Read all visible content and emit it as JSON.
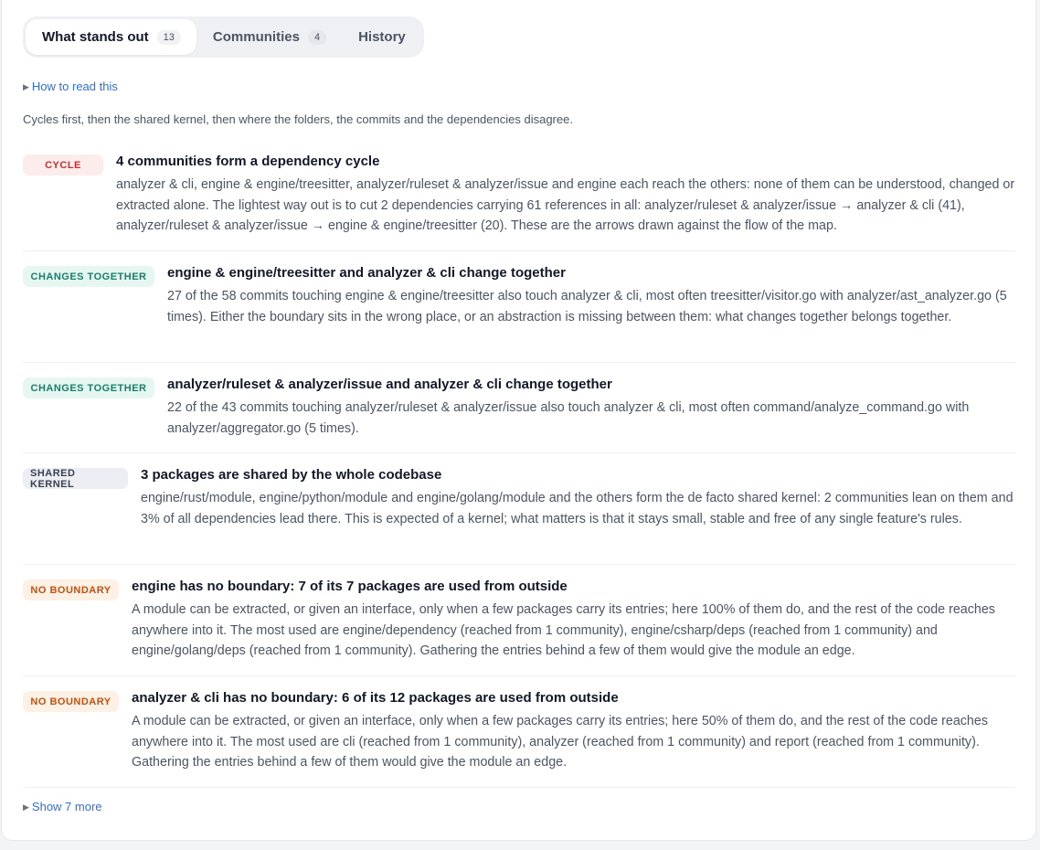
{
  "tabs": [
    {
      "label": "What stands out",
      "count": "13"
    },
    {
      "label": "Communities",
      "count": "4"
    },
    {
      "label": "History",
      "count": ""
    }
  ],
  "how_to_read": "How to read this",
  "intro": "Cycles first, then the shared kernel, then where the folders, the commits and the dependencies disagree.",
  "findings": [
    {
      "badge": "CYCLE",
      "title": "4 communities form a dependency cycle",
      "text": "analyzer & cli, engine & engine/treesitter, analyzer/ruleset & analyzer/issue and engine each reach the others: none of them can be understood, changed or extracted alone. The lightest way out is to cut 2 dependencies carrying 61 references in all: analyzer/ruleset & analyzer/issue → analyzer & cli (41), analyzer/ruleset & analyzer/issue → engine & engine/treesitter (20). These are the arrows drawn against the flow of the map."
    },
    {
      "badge": "CHANGES TOGETHER",
      "title": "engine & engine/treesitter and analyzer & cli change together",
      "text": "27 of the 58 commits touching engine & engine/treesitter also touch analyzer & cli, most often treesitter/visitor.go with analyzer/ast_analyzer.go (5 times). Either the boundary sits in the wrong place, or an abstraction is missing between them: what changes together belongs together."
    },
    {
      "badge": "CHANGES TOGETHER",
      "title": "analyzer/ruleset & analyzer/issue and analyzer & cli change together",
      "text": "22 of the 43 commits touching analyzer/ruleset & analyzer/issue also touch analyzer & cli, most often command/analyze_command.go with analyzer/aggregator.go (5 times)."
    },
    {
      "badge": "SHARED KERNEL",
      "title": "3 packages are shared by the whole codebase",
      "text": "engine/rust/module, engine/python/module and engine/golang/module and the others form the de facto shared kernel: 2 communities lean on them and 3% of all dependencies lead there. This is expected of a kernel; what matters is that it stays small, stable and free of any single feature's rules."
    },
    {
      "badge": "NO BOUNDARY",
      "title": "engine has no boundary: 7 of its 7 packages are used from outside",
      "text": "A module can be extracted, or given an interface, only when a few packages carry its entries; here 100% of them do, and the rest of the code reaches anywhere into it. The most used are engine/dependency (reached from 1 community), engine/csharp/deps (reached from 1 community) and engine/golang/deps (reached from 1 community). Gathering the entries behind a few of them would give the module an edge."
    },
    {
      "badge": "NO BOUNDARY",
      "title": "analyzer & cli has no boundary: 6 of its 12 packages are used from outside",
      "text": "A module can be extracted, or given an interface, only when a few packages carry its entries; here 50% of them do, and the rest of the code reaches anywhere into it. The most used are cli (reached from 1 community), analyzer (reached from 1 community) and report (reached from 1 community). Gathering the entries behind a few of them would give the module an edge."
    }
  ],
  "show_more": "Show 7 more"
}
